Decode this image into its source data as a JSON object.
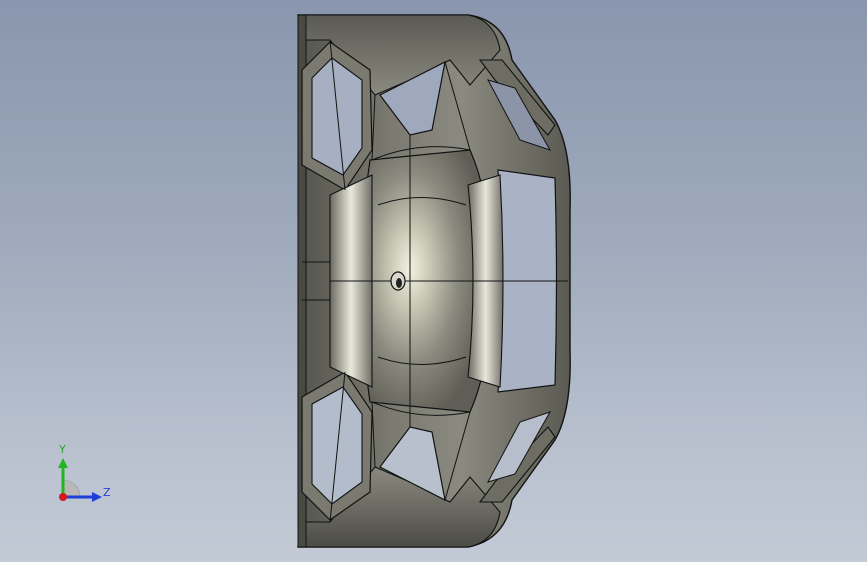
{
  "viewport": {
    "background_top": "#8996ad",
    "background_bottom": "#c3cad6"
  },
  "model": {
    "body_color": "#6f6f66",
    "highlight_color": "#e6e6d6",
    "edge_color": "#121212"
  },
  "triad": {
    "y_label": "Y",
    "z_label": "Z",
    "y_color": "#22b522",
    "z_color": "#1f3fd6",
    "x_color": "#d41a1a"
  }
}
